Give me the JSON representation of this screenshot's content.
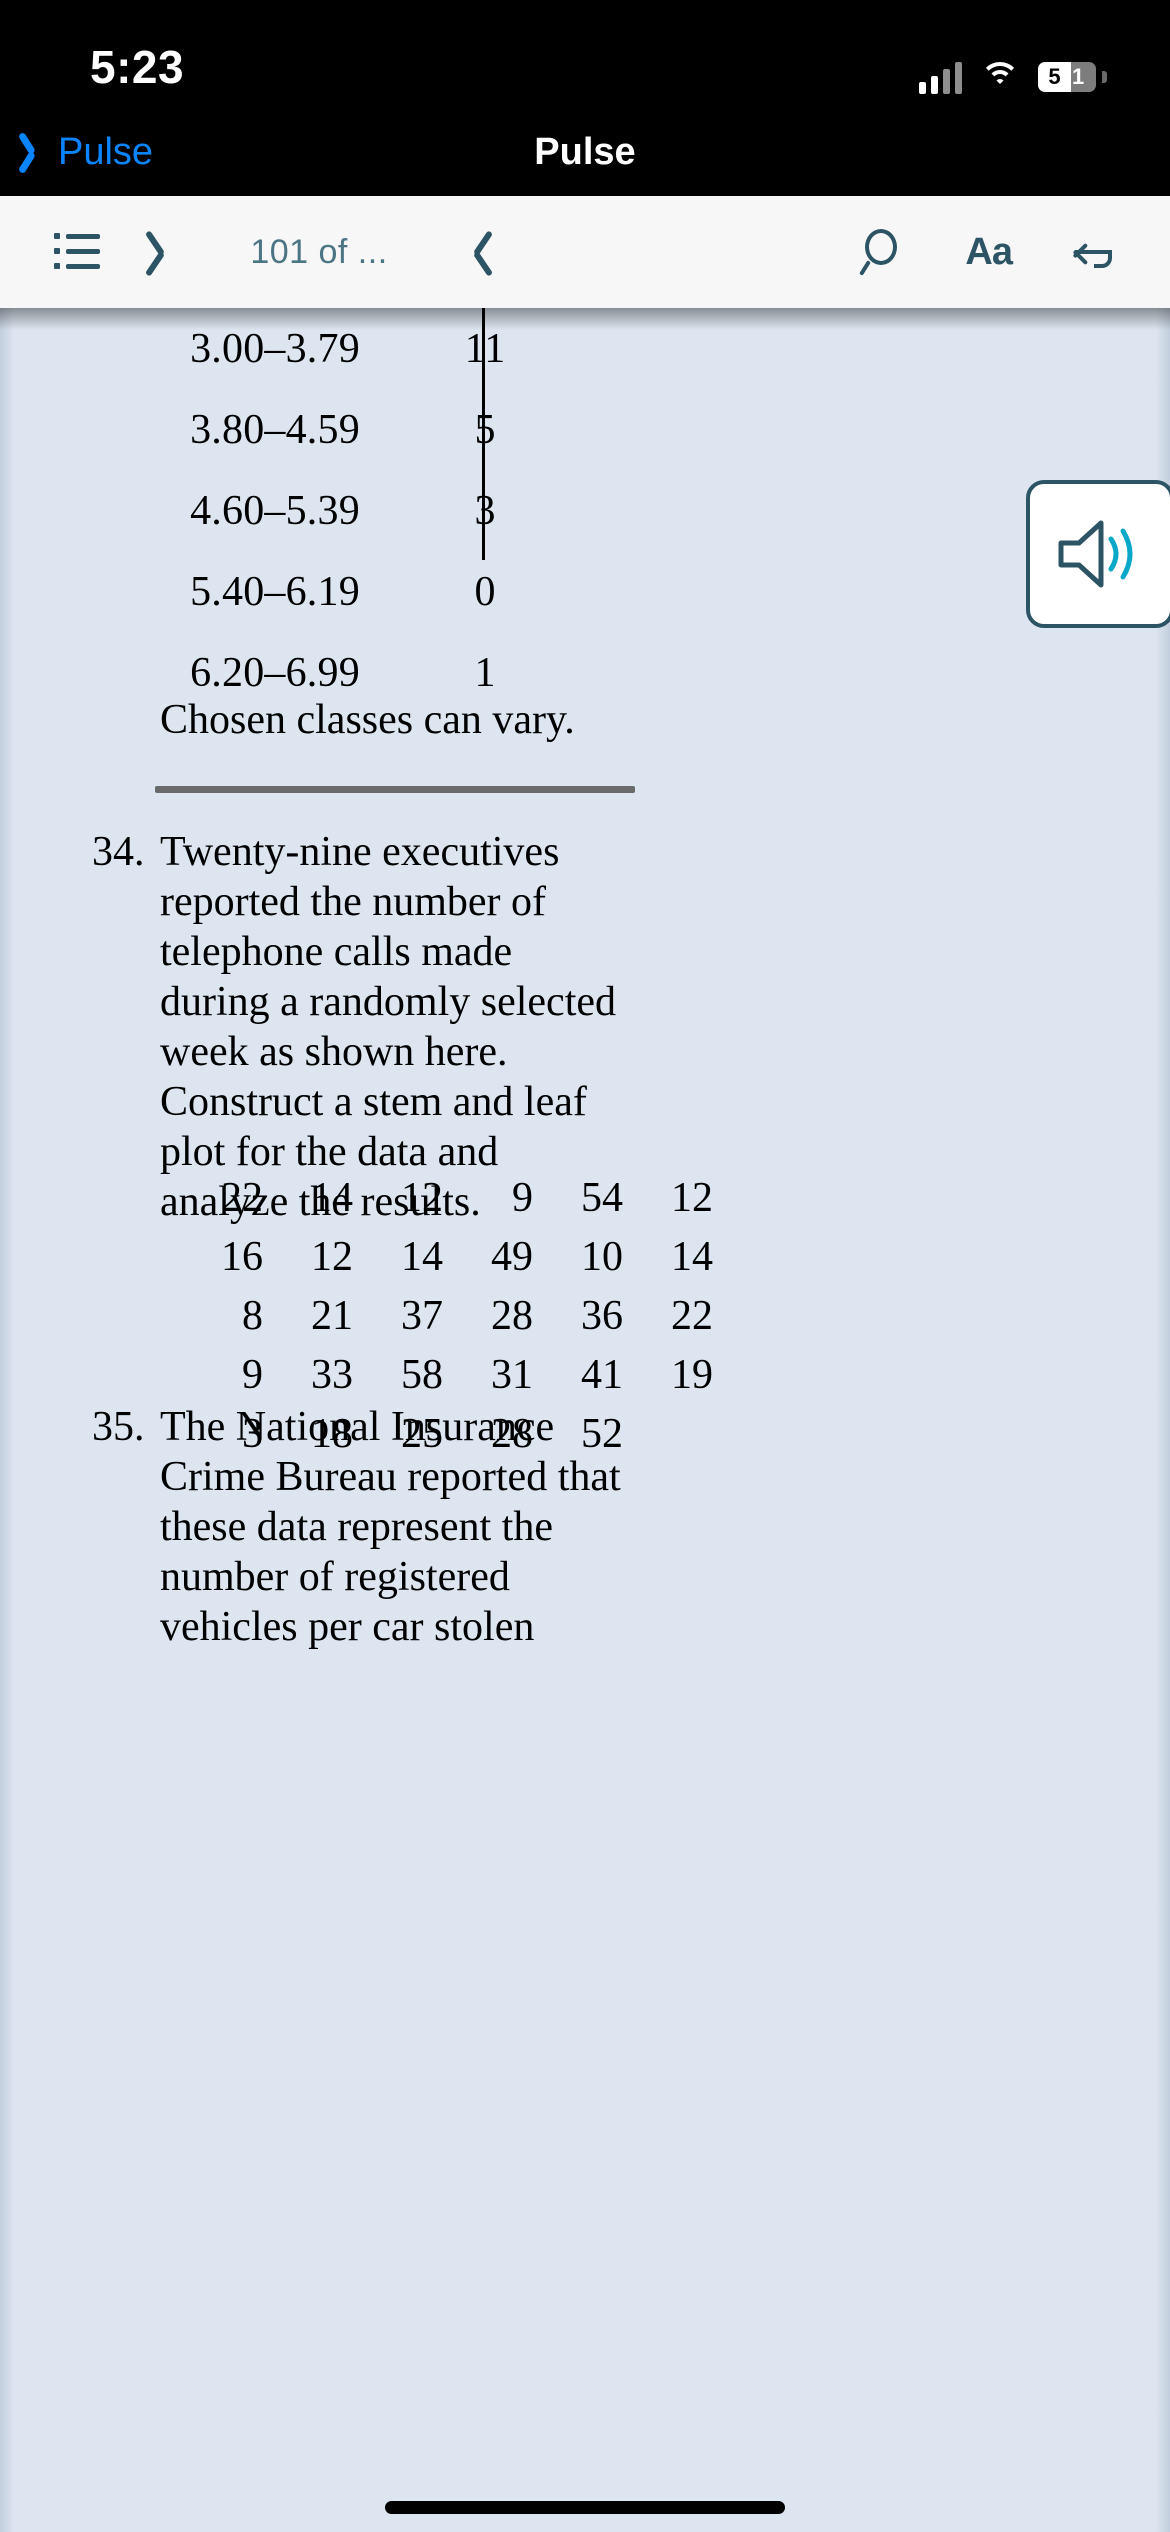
{
  "status_bar": {
    "time": "5:23",
    "battery_level": "51",
    "battery_digit_1": "5",
    "battery_digit_2": "1",
    "signal_icon": "cellular-signal-icon",
    "wifi_icon": "wifi-icon",
    "battery_icon": "battery-icon"
  },
  "nav_bar": {
    "back_label": "Pulse",
    "title": "Pulse",
    "back_icon": "chevron-left-icon",
    "accent_color": "#0a84ff"
  },
  "reader_toolbar": {
    "contents_icon": "list-contents-icon",
    "prev_icon": "chevron-left-icon",
    "next_icon": "chevron-right-icon",
    "page_indicator": "101 of ...",
    "search_icon": "search-icon",
    "text_size_label": "Aa",
    "undo_icon": "undo-arrow-icon",
    "icon_color": "#2c5464"
  },
  "speaker_button": {
    "icon": "speaker-volume-icon",
    "border_color": "#2c5464",
    "wave_color": "#0aa8c8"
  },
  "content": {
    "background_color": "#dce5f0",
    "frequency_table": {
      "rows": [
        {
          "class": "3.00–3.79",
          "frequency": "11"
        },
        {
          "class": "3.80–4.59",
          "frequency": "5"
        },
        {
          "class": "4.60–5.39",
          "frequency": "3"
        },
        {
          "class": "5.40–6.19",
          "frequency": "0"
        },
        {
          "class": "6.20–6.99",
          "frequency": "1"
        }
      ]
    },
    "note": "Chosen classes can vary.",
    "problems": [
      {
        "number": "34.",
        "text": "Twenty-nine executives reported the number of telephone calls made during a randomly selected week as shown here. Construct a stem and leaf plot for the data and analyze the results."
      },
      {
        "number": "35.",
        "text": "The National Insurance Crime Bureau reported that these data represent the number of registered vehicles per car stolen"
      }
    ],
    "data_grid": {
      "rows": [
        [
          "22",
          "14",
          "12",
          "9",
          "54",
          "12"
        ],
        [
          "16",
          "12",
          "14",
          "49",
          "10",
          "14"
        ],
        [
          "8",
          "21",
          "37",
          "28",
          "36",
          "22"
        ],
        [
          "9",
          "33",
          "58",
          "31",
          "41",
          "19"
        ],
        [
          "3",
          "18",
          "25",
          "28",
          "52",
          ""
        ]
      ]
    }
  }
}
